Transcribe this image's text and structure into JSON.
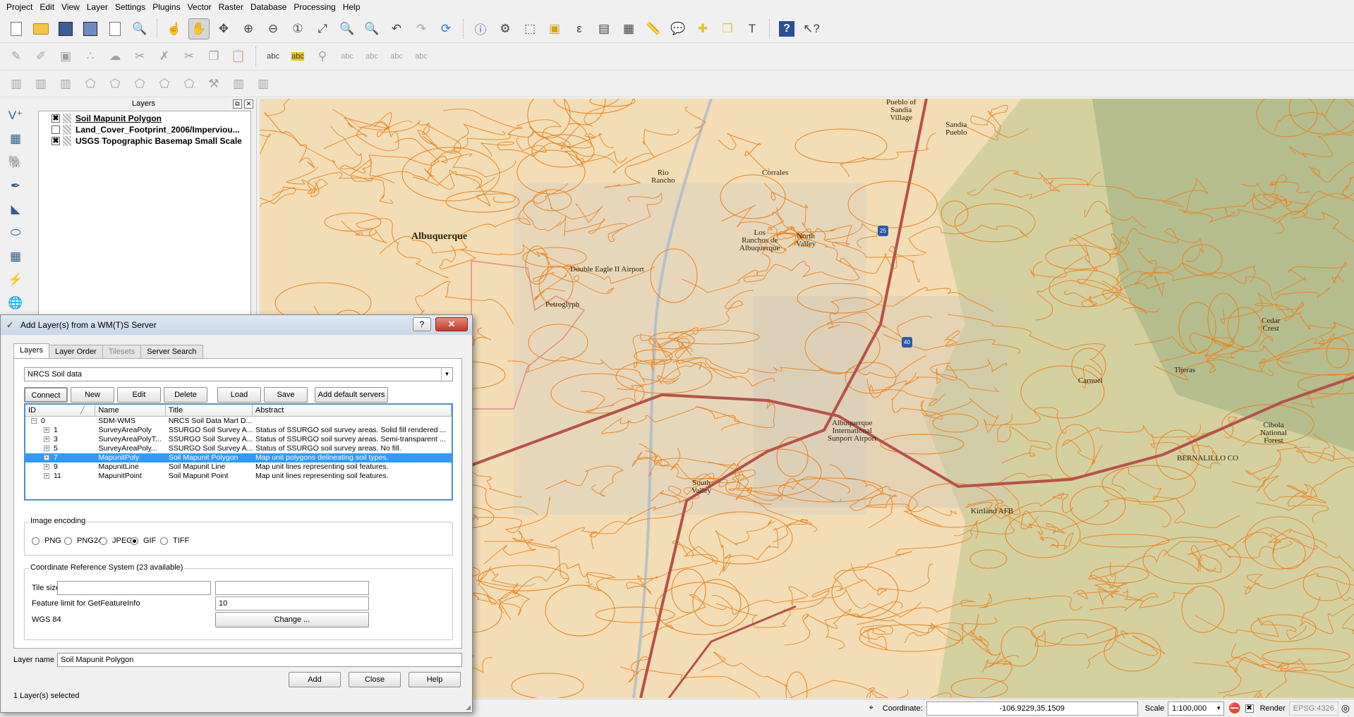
{
  "menu": [
    "Project",
    "Edit",
    "View",
    "Layer",
    "Settings",
    "Plugins",
    "Vector",
    "Raster",
    "Database",
    "Processing",
    "Help"
  ],
  "layers_panel": {
    "title": "Layers",
    "items": [
      {
        "name": "Soil Mapunit Polygon",
        "checked": "✖"
      },
      {
        "name": "Land_Cover_Footprint_2006/Imperviou...",
        "checked": ""
      },
      {
        "name": "USGS Topographic Basemap Small Scale",
        "checked": "✖"
      }
    ]
  },
  "map_labels": {
    "rio_rancho": "Rio\nRancho",
    "corrales": "Corrales",
    "pueblo_sandia": "Pueblo of\nSandia\nVillage",
    "sandia_pueblo": "Sandia\nPueblo",
    "albuquerque": "Albuquerque",
    "los_ranchos": "Los\nRanchos de\nAlbuquerque",
    "north_valley": "North\nValley",
    "petroglyph": "Petroglyph",
    "double_eagle": "Double Eagle II Airport",
    "sunport": "Albuquerque\nInternational\nSunport Airport",
    "south_valley": "South\nValley",
    "kirtland": "Kirtland AFB",
    "carnuel": "Carnuel",
    "tijeras": "Tijeras",
    "cedar_crest": "Cedar\nCrest",
    "cibola": "Cibola\nNational\nForest",
    "bernalillo": "BERNALILLO CO",
    "i25": "25",
    "i40": "40"
  },
  "statusbar": {
    "coordinate_label": "Coordinate:",
    "coordinate_value": "-106.9229,35.1509",
    "scale_label": "Scale",
    "scale_value": "1:100,000",
    "render_label": "Render",
    "render_checked": "✖",
    "crs": "EPSG:4326"
  },
  "dialog": {
    "title": "Add Layer(s) from a WM(T)S Server",
    "help_btn": "?",
    "close_btn": "✕",
    "tabs": [
      "Layers",
      "Layer Order",
      "Tilesets",
      "Server Search"
    ],
    "server": "NRCS Soil data",
    "buttons": {
      "connect": "Connect",
      "new": "New",
      "edit": "Edit",
      "delete": "Delete",
      "load": "Load",
      "save": "Save",
      "add_default": "Add default servers",
      "change": "Change ...",
      "add": "Add",
      "close": "Close",
      "help": "Help"
    },
    "table": {
      "headers": [
        "ID",
        "Name",
        "Title",
        "Abstract"
      ],
      "rows": [
        {
          "id": "0",
          "name": "SDM-WMS",
          "title": "NRCS Soil Data Mart D...",
          "abstract": "",
          "indent": 0,
          "expander": "−"
        },
        {
          "id": "1",
          "name": "SurveyAreaPoly",
          "title": "SSURGO Soil Survey A...",
          "abstract": "Status of SSURGO soil survey areas. Solid fill rendered ...",
          "indent": 1,
          "expander": "+"
        },
        {
          "id": "3",
          "name": "SurveyAreaPolyT...",
          "title": "SSURGO Soil Survey A...",
          "abstract": "Status of SSURGO soil survey areas. Semi-transparent ...",
          "indent": 1,
          "expander": "+"
        },
        {
          "id": "5",
          "name": "SurveyAreaPoly...",
          "title": "SSURGO Soil Survey A...",
          "abstract": "Status of SSURGO soil survey areas. No fill.",
          "indent": 1,
          "expander": "+"
        },
        {
          "id": "7",
          "name": "MapunitPoly",
          "title": "Soil Mapunit Polygon",
          "abstract": "Map unit polygons delineating soil types.",
          "indent": 1,
          "expander": "+",
          "selected": true
        },
        {
          "id": "9",
          "name": "MapunitLine",
          "title": "Soil Mapunit Line",
          "abstract": "Map unit lines representing soil features.",
          "indent": 1,
          "expander": "+"
        },
        {
          "id": "11",
          "name": "MapunitPoint",
          "title": "Soil Mapunit Point",
          "abstract": "Map unit lines representing soil features.",
          "indent": 1,
          "expander": "+"
        }
      ]
    },
    "image_encoding": {
      "title": "Image encoding",
      "options": [
        "PNG",
        "PNG24",
        "JPEG",
        "GIF",
        "TIFF"
      ],
      "selected": "GIF"
    },
    "crs": {
      "title": "Coordinate Reference System (23 available)",
      "tile_size_label": "Tile size",
      "tile_w": "",
      "tile_h": "",
      "feature_limit_label": "Feature limit for GetFeatureInfo",
      "feature_limit_value": "10",
      "crs_name": "WGS 84"
    },
    "layer_name_label": "Layer name",
    "layer_name_value": "Soil Mapunit Polygon",
    "status": "1 Layer(s) selected"
  },
  "colors": {
    "map_bg": "#f3ddb6",
    "soil_lines": "#e8821e",
    "highway": "#b5524a",
    "selection": "#3399ff",
    "close_btn": "#c0392b"
  }
}
